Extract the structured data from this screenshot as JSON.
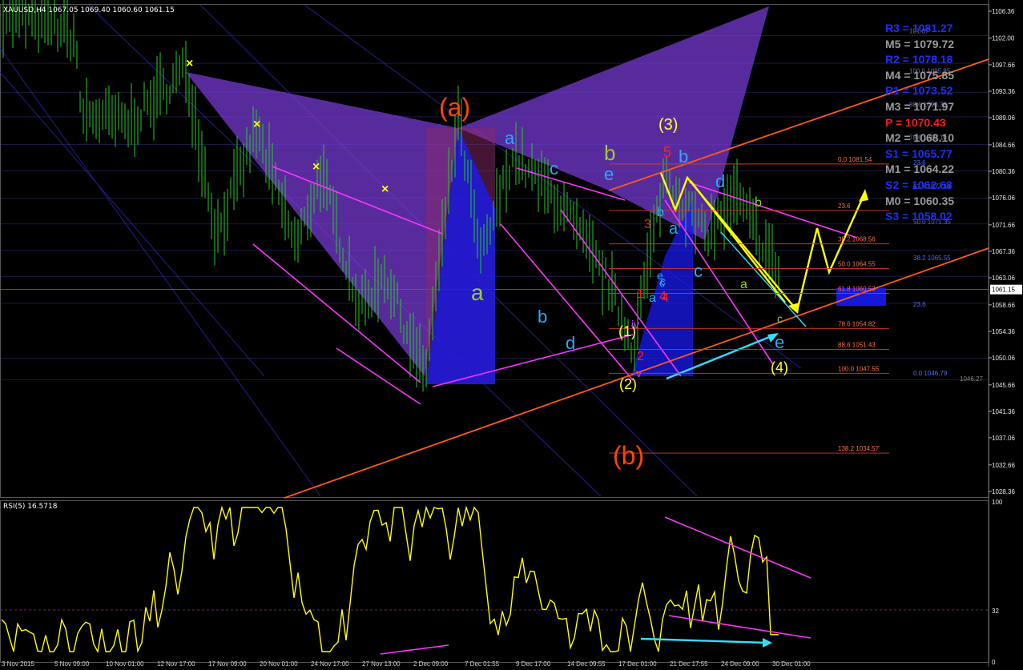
{
  "chart_data": [
    {
      "type": "line",
      "title": "XAUUSD,H4 1067.05 1069.40 1060.60 1061.15",
      "instrument": "XAUUSD,H4",
      "ohlc_header": "XAUUSD,H4 1067.05 1069.40 1060.60 1061.15",
      "last_price": 1061.15,
      "price_ticks": [
        "1106.36",
        "1102.00",
        "1097.66",
        "1093.36",
        "1089.06",
        "1084.66",
        "1080.36",
        "1076.06",
        "1071.66",
        "1067.36",
        "1063.06",
        "1058.66",
        "1054.36",
        "1050.06",
        "1045.66",
        "1041.36",
        "1037.06",
        "1032.66",
        "1028.36"
      ],
      "ylim": [
        1027.3,
        1107.4
      ],
      "x_labels": [
        "3 Nov 2015",
        "5 Nov 09:00",
        "10 Nov 01:00",
        "12 Nov 17:00",
        "17 Nov 09:00",
        "20 Nov 01:00",
        "24 Nov 17:00",
        "27 Nov 13:00",
        "2 Dec 09:00",
        "7 Dec 01:55",
        "9 Dec 17:00",
        "14 Dec 09:55",
        "17 Dec 01:00",
        "21 Dec 17:55",
        "24 Dec 09:00",
        "30 Dec 01:00"
      ],
      "pivots": [
        {
          "label": "R3 = 1081.27",
          "color": "#1e2cff"
        },
        {
          "label": "M5 = 1079.72",
          "color": "#9a9a9a"
        },
        {
          "label": "R2 = 1078.18",
          "color": "#1e2cff"
        },
        {
          "label": "M4 = 1075.85",
          "color": "#9a9a9a"
        },
        {
          "label": "R1 = 1073.52",
          "color": "#1e2cff"
        },
        {
          "label": "M3 = 1071.97",
          "color": "#9a9a9a"
        },
        {
          "label": "P  = 1070.43",
          "color": "#ff1a1a"
        },
        {
          "label": "M2 = 1068.10",
          "color": "#9a9a9a"
        },
        {
          "label": "S1 = 1065.77",
          "color": "#1e2cff"
        },
        {
          "label": "M1 = 1064.22",
          "color": "#9a9a9a"
        },
        {
          "label": "S2 = 1062.68",
          "color": "#1e2cff"
        },
        {
          "label": "M0 = 1060.35",
          "color": "#9a9a9a"
        },
        {
          "label": "S3 = 1058.02",
          "color": "#1e2cff"
        }
      ],
      "fib_red": [
        {
          "label": "0.0 1081.54",
          "price": 1081.54
        },
        {
          "label": "23.6",
          "price": 1074.0
        },
        {
          "label": "38.2 1068.56",
          "price": 1068.56
        },
        {
          "label": "50.0 1064.55",
          "price": 1064.55
        },
        {
          "label": "61.8 1060.53",
          "price": 1060.53
        },
        {
          "label": "78.6 1054.82",
          "price": 1054.82
        },
        {
          "label": "88.6 1051.43",
          "price": 1051.43
        },
        {
          "label": "100.0 1047.55",
          "price": 1047.55
        },
        {
          "label": "138.2 1034.57",
          "price": 1034.57
        }
      ],
      "fib_blue": [
        {
          "label": "23.6",
          "price": 1081.0
        },
        {
          "label": "61.8 1077.14",
          "price": 1077.14
        },
        {
          "label": "50.0 1071.35",
          "price": 1071.35
        },
        {
          "label": "38.2 1065.55",
          "price": 1065.55
        },
        {
          "label": "23.6",
          "price": 1058.0
        },
        {
          "label": "0.0 1046.79",
          "price": 1046.79
        }
      ],
      "fib_grey": [
        {
          "label": "101.87",
          "price": 1102.4
        },
        {
          "label": "100.0 1095.85",
          "price": 1095.9
        },
        {
          "label": "88.6 1090.38",
          "price": 1090.4
        },
        {
          "label": "78.6 1085.10",
          "price": 1085.1
        }
      ],
      "gray_labels": [
        "1046.27"
      ],
      "wave_labels": [
        {
          "text": "(a)",
          "color": "#ff4500"
        },
        {
          "text": "(b)",
          "color": "#ff4500"
        },
        {
          "text": "(3)",
          "color": "#ffff33"
        },
        {
          "text": "(4)",
          "color": "#ffff33"
        },
        {
          "text": "(1)",
          "color": "#ffff33"
        },
        {
          "text": "(2)",
          "color": "#ffff33"
        },
        {
          "text": "a",
          "color": "#9acd32"
        },
        {
          "text": "b",
          "color": "#9acd32"
        },
        {
          "text": "a",
          "color": "#29aaff"
        },
        {
          "text": "b",
          "color": "#29aaff"
        },
        {
          "text": "c",
          "color": "#29aaff"
        },
        {
          "text": "d",
          "color": "#29aaff"
        },
        {
          "text": "e",
          "color": "#29aaff"
        },
        {
          "text": "5",
          "color": "#ff2020"
        },
        {
          "text": "3",
          "color": "#ff2020"
        },
        {
          "text": "4",
          "color": "#ff2020"
        },
        {
          "text": "1",
          "color": "#ff2020"
        },
        {
          "text": "2",
          "color": "#ff2020"
        },
        {
          "text": "b",
          "color": "#29aaff"
        },
        {
          "text": "a",
          "color": "#29aaff"
        },
        {
          "text": "c",
          "color": "#29aaff"
        },
        {
          "text": "b",
          "color": "#29aaff"
        },
        {
          "text": "d",
          "color": "#29aaff"
        },
        {
          "text": "c",
          "color": "#29aaff"
        },
        {
          "text": "e",
          "color": "#29aaff"
        },
        {
          "text": "a",
          "color": "#9acd32"
        },
        {
          "text": "b",
          "color": "#9acd32"
        },
        {
          "text": "c",
          "color": "#9acd32"
        },
        {
          "text": "e",
          "color": "#29aaff"
        },
        {
          "text": "a",
          "color": "#29aaff"
        },
        {
          "text": "c",
          "color": "#29aaff"
        },
        {
          "text": "4",
          "color": "#ff2020"
        },
        {
          "text": "v",
          "color": "#cc33ff"
        },
        {
          "text": "iv",
          "color": "#cc33ff"
        }
      ],
      "markers": [
        "×",
        "×",
        "×",
        "×"
      ],
      "colors": {
        "bars": "#22cc22",
        "magenta": "#ff33ff",
        "orange": "#ff5a1a",
        "yellow": "#ffff00",
        "cyan": "#33ddff",
        "purple": "#7a3cd8",
        "blue": "#1a1aee",
        "grid_blue": "#2a2aa0"
      }
    },
    {
      "type": "line",
      "title": "RSI(5) 16.5718",
      "indicator": "RSI(5)",
      "value": 16.5718,
      "ylim": [
        0,
        100
      ],
      "ticks": [
        "100",
        "32",
        "0"
      ],
      "level": 32,
      "color": "#ffff00"
    }
  ]
}
